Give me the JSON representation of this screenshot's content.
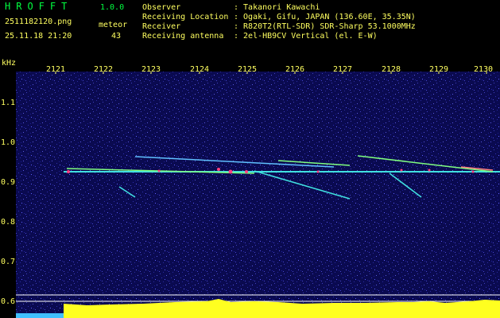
{
  "header": {
    "app_title": "HROFFT",
    "version": "1.0.0",
    "filename": "2511182120.png",
    "meteor_label": "meteor",
    "meteor_count": "43",
    "datetime": "25.11.18 21:20",
    "info": [
      {
        "label": "Observer",
        "value": ": Takanori Kawachi"
      },
      {
        "label": "Receiving Location",
        "value": ": Ogaki, Gifu, JAPAN (136.60E, 35.35N)"
      },
      {
        "label": "Receiver",
        "value": ": R820T2(RTL-SDR) SDR-Sharp 53.1000MHz"
      },
      {
        "label": "Receiving antenna",
        "value": ": 2el-HB9CV Vertical (el. E-W)"
      }
    ]
  },
  "axes": {
    "freq_unit": "kHz",
    "time_ticks": [
      "2121",
      "2122",
      "2123",
      "2124",
      "2125",
      "2126",
      "2127",
      "2128",
      "2129",
      "2130"
    ],
    "freq_ticks": [
      "1.1",
      "1.0",
      "0.9",
      "0.8",
      "0.7",
      "0.6"
    ]
  },
  "colors": {
    "text_green": "#00ff40",
    "text_yellow": "#ffff60",
    "background": "#0a0a50",
    "signal": "#ff4080"
  }
}
